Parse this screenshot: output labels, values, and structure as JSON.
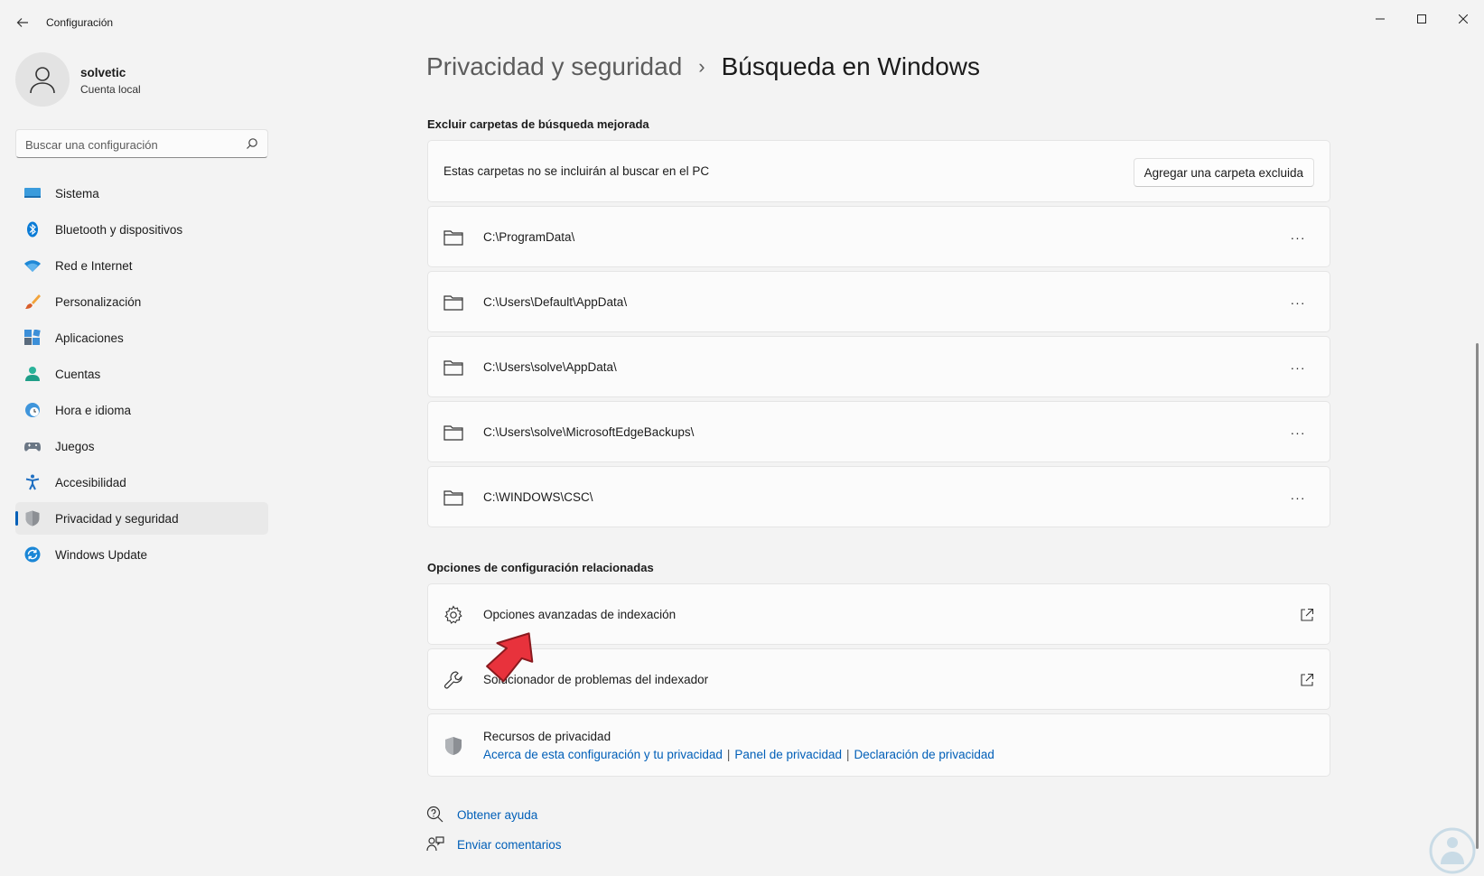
{
  "window": {
    "title": "Configuración",
    "controls": {
      "minimize": "—",
      "maximize": "☐",
      "close": "✕"
    }
  },
  "user": {
    "name": "solvetic",
    "account_type": "Cuenta local"
  },
  "search": {
    "placeholder": "Buscar una configuración"
  },
  "sidebar": {
    "items": [
      {
        "label": "Sistema",
        "icon": "monitor-icon",
        "active": false
      },
      {
        "label": "Bluetooth y dispositivos",
        "icon": "bluetooth-icon",
        "active": false
      },
      {
        "label": "Red e Internet",
        "icon": "wifi-icon",
        "active": false
      },
      {
        "label": "Personalización",
        "icon": "brush-icon",
        "active": false
      },
      {
        "label": "Aplicaciones",
        "icon": "apps-icon",
        "active": false
      },
      {
        "label": "Cuentas",
        "icon": "person-icon",
        "active": false
      },
      {
        "label": "Hora e idioma",
        "icon": "globe-clock-icon",
        "active": false
      },
      {
        "label": "Juegos",
        "icon": "gamepad-icon",
        "active": false
      },
      {
        "label": "Accesibilidad",
        "icon": "accessibility-icon",
        "active": false
      },
      {
        "label": "Privacidad y seguridad",
        "icon": "shield-icon",
        "active": true
      },
      {
        "label": "Windows Update",
        "icon": "update-icon",
        "active": false
      }
    ]
  },
  "breadcrumb": {
    "parent": "Privacidad y seguridad",
    "separator": "›",
    "current": "Búsqueda en Windows"
  },
  "exclude_section": {
    "title": "Excluir carpetas de búsqueda mejorada",
    "description": "Estas carpetas no se incluirán al buscar en el PC",
    "add_button": "Agregar una carpeta excluida",
    "folders": [
      "C:\\ProgramData\\",
      "C:\\Users\\Default\\AppData\\",
      "C:\\Users\\solve\\AppData\\",
      "C:\\Users\\solve\\MicrosoftEdgeBackups\\",
      "C:\\WINDOWS\\CSC\\"
    ],
    "more_label": "···"
  },
  "related_section": {
    "title": "Opciones de configuración relacionadas",
    "items": [
      {
        "label": "Opciones avanzadas de indexación",
        "icon": "gear-icon"
      },
      {
        "label": "Solucionador de problemas del indexador",
        "icon": "wrench-icon"
      }
    ],
    "privacy": {
      "title": "Recursos de privacidad",
      "links": [
        "Acerca de esta configuración y tu privacidad",
        "Panel de privacidad",
        "Declaración de privacidad"
      ],
      "separator": "|"
    }
  },
  "footer": {
    "help": "Obtener ayuda",
    "feedback": "Enviar comentarios"
  },
  "colors": {
    "accent": "#005fb8",
    "background": "#f3f3f3",
    "card": "#fbfbfb",
    "pointer_arrow": "#e8323c"
  }
}
